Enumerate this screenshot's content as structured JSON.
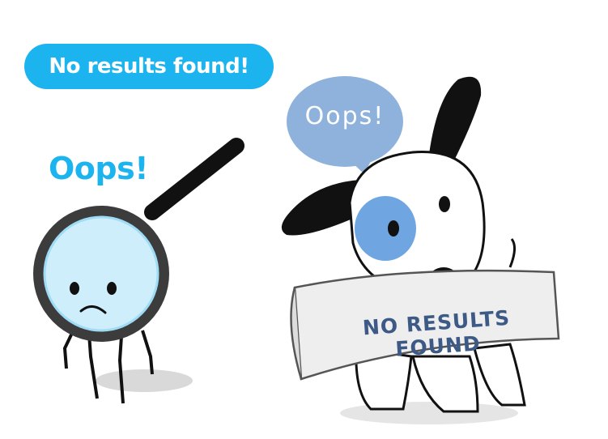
{
  "header": {
    "title": "No results found!"
  },
  "magnifier": {
    "exclamation": "Oops!"
  },
  "dog": {
    "speech": "Oops!",
    "banner": "NO RESULTS FOUND"
  },
  "colors": {
    "accent": "#1cb4ee",
    "lens": "#cfeefc",
    "dog_patch": "#6fa6e2",
    "bubble": "#8fb2dc",
    "banner_text": "#3d5a86"
  }
}
